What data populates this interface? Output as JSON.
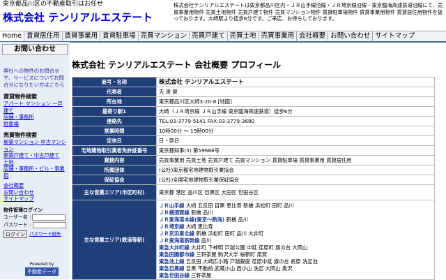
{
  "header": {
    "catch": "東京都品川区の不動産取引はお任せ",
    "brand": "株式会社 テンリアルエステート",
    "intro": "株式会社テンリアルエステートは東京都品川区内・ＪＲ山手線沿線・ＪＲ埼京線沿線・東京臨海高速鉄道沿線にて、売買事業用物件 売買土地物件 売買戸建て物件 売買マンション物件 賃貸駐車場物件 賃貸事業用物件 賃貸居住用物件を扱っております。大崎駅より徒歩6分です。ご来店、お待ちしております。"
  },
  "nav": [
    "Home",
    "賃貸居住用",
    "賃貸事業用",
    "賃貸駐車場",
    "売買マンション",
    "売買戸建て",
    "売買土地",
    "売買事業用",
    "会社概要",
    "お問い合わせ",
    "サイトマップ"
  ],
  "sidebar": {
    "contact_button": "お問い合わせ",
    "contact_text": "弊社への物件のお問合せや、サービスについてお問合せになりたい方はこちら",
    "rent_head": "賃貸物件検索",
    "rent_links": [
      "アパート マンション 一戸建て",
      "店舗・事務所",
      "駐車場"
    ],
    "sale_head": "売買物件検索",
    "sale_links": [
      "新築マンション 中古マンション",
      "新築戸建て・中古戸建て",
      "土地",
      "店舗・事務所・ビル・事業用"
    ],
    "misc_links": [
      "会社概要",
      "お問い合わせ",
      "サイトマップ"
    ],
    "login_title": "物件管理ログイン",
    "user_label": "ユーザー名 :",
    "pass_label": "パスワード :",
    "login_button": "ログイン",
    "forgot_link": "パスワード紛失",
    "powered_by": "Powered by",
    "powered_logo": "不動産データ"
  },
  "main": {
    "title": "株式会社 テンリアルエステート 会社概要 プロフィール",
    "rows": [
      {
        "label": "商号・名称",
        "value": "株式会社 テンリアルエステート",
        "big": true
      },
      {
        "label": "代表者",
        "value": "天 達 健"
      },
      {
        "label": "所在地",
        "value": "東京都品川区大崎3-20-8 [地図]"
      },
      {
        "label": "最寄り駅1",
        "value": "大崎（ＪＲ埼京線 ＪＲ山手線 東京臨海高速鉄道）徒歩6分"
      },
      {
        "label": "連絡先",
        "value": "TEL:03-3779-5141 FAX:03-3779-3680"
      },
      {
        "label": "営業時間",
        "value": "10時00分 ～ 19時00分"
      },
      {
        "label": "定休日",
        "value": "日・祭日"
      },
      {
        "label": "宅地建物取引業者免許証番号",
        "value": "東京都知事(5) 第59688号"
      },
      {
        "label": "業務内容",
        "value": "売買事業用 売買土地 売買戸建て 売買マンション 賃貸駐車場 賃貸事業用 賃貸居住用"
      },
      {
        "label": "所属団体",
        "value": "(公社)東京都宅地建物取引業協会"
      },
      {
        "label": "保証協会",
        "value": "(公社)全国宅地建物取引業保証協会"
      },
      {
        "label": "主な営業エリア(市区町村)",
        "value": "東京都 港区 品川区 目黒区 大田区 世田谷区"
      }
    ],
    "area_label": "主な営業エリア(鉄道等駅)",
    "area_lines": [
      {
        "line": "ＪＲ山手線",
        "stations": "大崎 五反田 目黒 恵比寿 新橋 浜松町 田町 品川"
      },
      {
        "line": "ＪＲ横須賀線",
        "stations": "新橋 品川"
      },
      {
        "line": "ＪＲ東海道本線(東京～熱海)",
        "stations": "新橋 品川"
      },
      {
        "line": "ＪＲ埼京線",
        "stations": "大崎 恵比寿"
      },
      {
        "line": "ＪＲ京浜東北線",
        "stations": "新橋 浜松町 田町 品川 大井町"
      },
      {
        "line": "ＪＲ東海道新幹線",
        "stations": "品川"
      },
      {
        "line": "東急大井町線",
        "stations": "大井町 下神明 戸越公園 中延 荏原町 旗の台 大岡山"
      },
      {
        "line": "東急田園都市線",
        "stations": "三軒茶屋 駒沢大学 桜新町 用賀"
      },
      {
        "line": "東急池上線",
        "stations": "五反田 大崎広小路 戸越銀座 荏原中延 旗の台 長原 洗足池"
      },
      {
        "line": "東急目黒線",
        "stations": "目黒 不動前 武蔵小山 西小山 洗足 大岡山 奥沢"
      },
      {
        "line": "東急世田谷線",
        "stations": "三軒茶屋"
      }
    ]
  },
  "colors": {
    "nav_border": "#4a6a95",
    "table_header": "#1f3f7a",
    "brand": "#0000cc",
    "sidebar_bg": "#e7eef5"
  }
}
